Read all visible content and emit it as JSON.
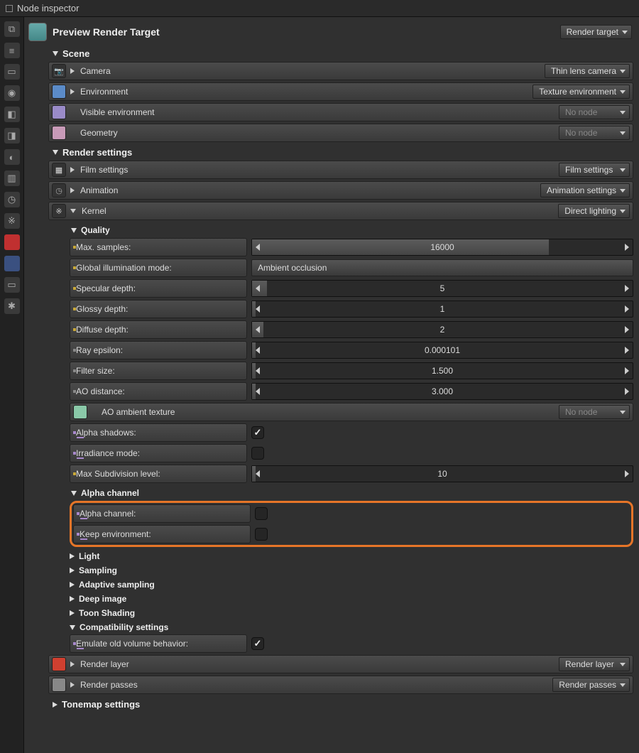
{
  "window_title": "Node inspector",
  "header": {
    "title": "Preview Render Target",
    "dropdown": "Render target"
  },
  "scene": {
    "title": "Scene",
    "camera": {
      "label": "Camera",
      "value": "Thin lens camera"
    },
    "environment": {
      "label": "Environment",
      "value": "Texture environment"
    },
    "visible_env": {
      "label": "Visible environment",
      "value": "No node"
    },
    "geometry": {
      "label": "Geometry",
      "value": "No node"
    }
  },
  "render_settings": {
    "title": "Render settings",
    "film": {
      "label": "Film settings",
      "value": "Film settings"
    },
    "animation": {
      "label": "Animation",
      "value": "Animation settings"
    },
    "kernel": {
      "label": "Kernel",
      "value": "Direct lighting"
    }
  },
  "quality": {
    "title": "Quality",
    "max_samples": {
      "label": "Max. samples:",
      "value": "16000",
      "fill": 78
    },
    "gi_mode": {
      "label": "Global illumination mode:",
      "value": "Ambient occlusion"
    },
    "specular": {
      "label": "Specular depth:",
      "value": "5",
      "fill": 1
    },
    "glossy": {
      "label": "Glossy depth:",
      "value": "1",
      "fill": 0
    },
    "diffuse": {
      "label": "Diffuse depth:",
      "value": "2",
      "fill": 2
    },
    "ray_eps": {
      "label": "Ray epsilon:",
      "value": "0.000101",
      "fill": 0
    },
    "filter_size": {
      "label": "Filter size:",
      "value": "1.500",
      "fill": 0
    },
    "ao_distance": {
      "label": "AO distance:",
      "value": "3.000",
      "fill": 0
    },
    "ao_texture": {
      "label": "AO ambient texture",
      "value": "No node"
    },
    "alpha_shadows": {
      "label": "Alpha shadows:",
      "checked": true
    },
    "irradiance": {
      "label": "Irradiance mode:",
      "checked": false
    },
    "max_subdiv": {
      "label": "Max Subdivision level:",
      "value": "10",
      "fill": 0
    }
  },
  "alpha_channel": {
    "title": "Alpha channel",
    "alpha": {
      "label": "Alpha channel:",
      "checked": false
    },
    "keep_env": {
      "label": "Keep environment:",
      "checked": false
    }
  },
  "mini_sections": {
    "light": "Light",
    "sampling": "Sampling",
    "adaptive": "Adaptive sampling",
    "deep": "Deep image",
    "toon": "Toon Shading",
    "compat": "Compatibility settings",
    "emulate": {
      "label": "Emulate old volume behavior:",
      "checked": true
    }
  },
  "bottom": {
    "render_layer": {
      "label": "Render layer",
      "value": "Render layer"
    },
    "render_passes": {
      "label": "Render passes",
      "value": "Render passes"
    },
    "tonemap": "Tonemap settings"
  }
}
